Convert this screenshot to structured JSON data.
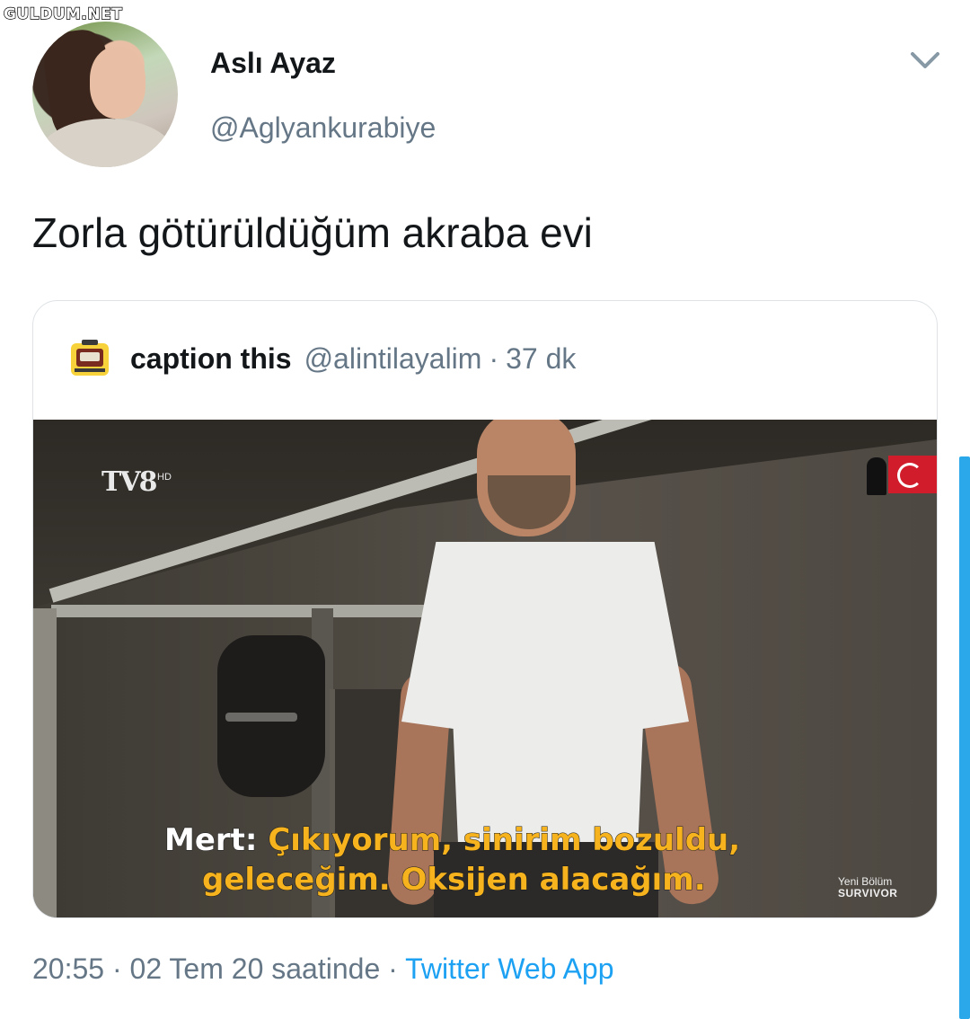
{
  "watermark": "GULDUM.NET",
  "tweet": {
    "author_name": "Aslı Ayaz",
    "author_handle": "@Aglyankurabiye",
    "text": "Zorla götürüldüğüm akraba evi",
    "timestamp": "20:55",
    "date": "02 Tem 20 saatinde",
    "separator": "·",
    "source": "Twitter Web App"
  },
  "quoted": {
    "name": "caption this",
    "handle": "@alintilayalim",
    "separator": "·",
    "age": "37 dk",
    "media": {
      "channel_logo": "TV8",
      "channel_hd": "HD",
      "subtitle_speaker": "Mert:",
      "subtitle_line1": "Çıkıyorum, sinirim bozuldu,",
      "subtitle_line2": "geleceğim. Oksijen alacağım.",
      "promo_line1": "Yeni Bölüm",
      "promo_line2": "SURVIVOR"
    }
  },
  "icons": {
    "menu": "chevron-down-icon",
    "avatar": "avatar"
  },
  "colors": {
    "secondary_text": "#657786",
    "link": "#1da1f2",
    "subtitle_yellow": "#f6b31e"
  }
}
